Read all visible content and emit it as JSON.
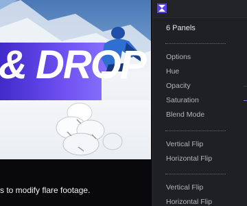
{
  "preview": {
    "banner_text": "& DROP",
    "caption": "s to modify flare footage."
  },
  "panel": {
    "logo_icon": "panel-logo-icon",
    "count_label": "6 Panels",
    "groups": [
      {
        "items": [
          "Options",
          "Hue",
          "Opacity",
          "Saturation",
          "Blend Mode"
        ]
      },
      {
        "items": [
          "Vertical Flip",
          "Horizontal Flip"
        ]
      },
      {
        "items": [
          "Vertical Flip",
          "Horizontal Flip"
        ]
      }
    ]
  },
  "colors": {
    "banner": "#5a3de8",
    "panel_bg": "#1f2024",
    "logo": "#5b3ee6",
    "marker_opacity": "#3b3c42",
    "marker_saturation": "#7a6cff"
  }
}
